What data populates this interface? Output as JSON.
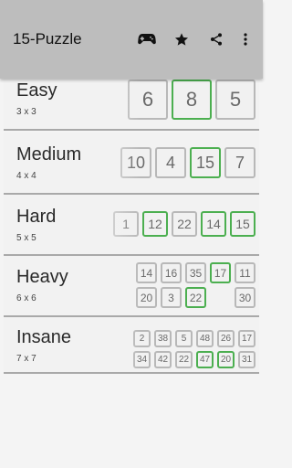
{
  "appbar": {
    "title": "15-Puzzle",
    "actions": [
      "gamepad-icon",
      "star-icon",
      "share-icon",
      "more-vert-icon"
    ]
  },
  "levels": [
    {
      "title": "Easy",
      "size": "3 x 3",
      "tiles": [
        "6",
        "8",
        "5"
      ],
      "correct": [
        false,
        true,
        false
      ]
    },
    {
      "title": "Medium",
      "size": "4 x 4",
      "tiles": [
        "10",
        "4",
        "15",
        "7"
      ],
      "correct": [
        false,
        false,
        true,
        false
      ]
    },
    {
      "title": "Hard",
      "size": "5 x 5",
      "tiles": [
        "1",
        "12",
        "22",
        "14",
        "15"
      ],
      "correct": [
        false,
        true,
        false,
        true,
        true
      ]
    },
    {
      "title": "Heavy",
      "size": "6 x 6",
      "tiles": [
        "14",
        "16",
        "35",
        "17",
        "11",
        "20",
        "3",
        "22",
        "",
        "30"
      ],
      "correct": [
        false,
        false,
        false,
        true,
        false,
        false,
        false,
        true,
        false,
        false
      ]
    },
    {
      "title": "Insane",
      "size": "7 x 7",
      "tiles": [
        "2",
        "38",
        "5",
        "48",
        "26",
        "17",
        "34",
        "42",
        "22",
        "47",
        "20",
        "31"
      ],
      "correct": [
        false,
        false,
        false,
        false,
        false,
        false,
        false,
        false,
        false,
        true,
        true,
        false
      ]
    }
  ],
  "colors": {
    "appbar": "#bdbdbd",
    "tile_ok_border": "#4caf50",
    "tile_border": "#b8b8b8"
  }
}
